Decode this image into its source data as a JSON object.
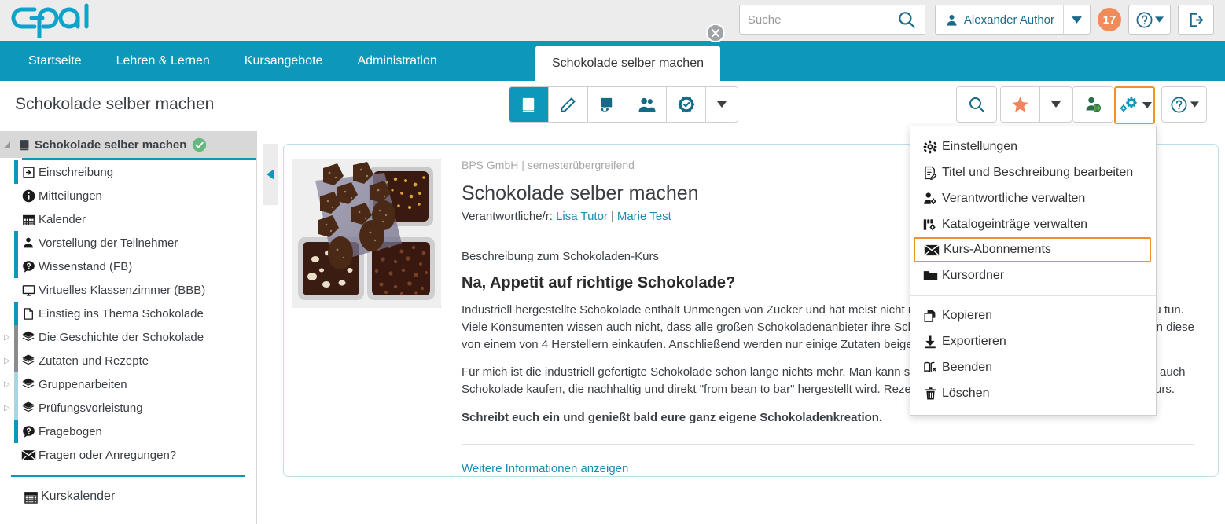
{
  "header": {
    "logo_alt": "OPAL",
    "search": {
      "placeholder": "Suche",
      "value": ""
    },
    "user_name": "Alexander Author",
    "notification_count": "17",
    "icons": {
      "search": "search-icon",
      "user": "user-icon",
      "caret": "chevron-down-icon",
      "help": "help-icon",
      "logout": "logout-icon"
    }
  },
  "nav": {
    "links": [
      {
        "label": "Startseite"
      },
      {
        "label": "Lehren & Lernen"
      },
      {
        "label": "Kursangebote"
      },
      {
        "label": "Administration"
      }
    ],
    "open_tab": {
      "label": "Schokolade selber machen",
      "close": "✕"
    }
  },
  "course_bar": {
    "title": "Schokolade selber machen",
    "left_tools": [
      {
        "name": "course-run-button",
        "icon": "book-icon",
        "active": true
      },
      {
        "name": "course-edit-button",
        "icon": "pencil-icon",
        "active": false
      },
      {
        "name": "course-preview-button",
        "icon": "preview-eye-icon",
        "active": false
      },
      {
        "name": "course-members-button",
        "icon": "members-icon",
        "active": false
      },
      {
        "name": "course-quality-button",
        "icon": "badge-check-icon",
        "active": false
      },
      {
        "name": "course-more-button",
        "icon": "chevron-down-icon",
        "active": false
      }
    ],
    "right_tools": [
      {
        "name": "course-search-button",
        "icon": "search-icon"
      },
      {
        "name": "course-favorite-button",
        "icon": "star-icon"
      },
      {
        "name": "course-favorite-caret",
        "icon": "chevron-down-icon"
      },
      {
        "name": "course-share-button",
        "icon": "user-globe-icon"
      },
      {
        "name": "course-settings-button",
        "icon": "gear-icon",
        "highlighted": true
      },
      {
        "name": "course-help-button",
        "icon": "help-icon"
      }
    ]
  },
  "sidebar": {
    "items": [
      {
        "label": "Schokolade selber machen",
        "icon": "book-icon",
        "level": 0,
        "root": true,
        "status": "check-circle-icon",
        "twisty": "◢"
      },
      {
        "label": "Einschreibung",
        "icon": "enrol-icon",
        "level": 1,
        "bar": "#0d97b8"
      },
      {
        "label": "Mitteilungen",
        "icon": "info-icon",
        "level": 1,
        "bar": ""
      },
      {
        "label": "Kalender",
        "icon": "calendar-icon",
        "level": 1,
        "bar": ""
      },
      {
        "label": "Vorstellung der Teilnehmer",
        "icon": "person-icon",
        "level": 1,
        "bar": "#0d97b8"
      },
      {
        "label": "Wissenstand (FB)",
        "icon": "question-bubble-icon",
        "level": 1,
        "bar": "#0d97b8"
      },
      {
        "label": "Virtuelles Klassenzimmer (BBB)",
        "icon": "monitor-icon",
        "level": 1,
        "bar": ""
      },
      {
        "label": "Einstieg ins Thema Schokolade",
        "icon": "page-icon",
        "level": 1,
        "bar": "#0d97b8"
      },
      {
        "label": "Die Geschichte der Schokolade",
        "icon": "layers-icon",
        "level": 1,
        "bar": "#8c8c8c",
        "twisty": "▷"
      },
      {
        "label": "Zutaten und Rezepte",
        "icon": "layers-icon",
        "level": 1,
        "bar": "#8c8c8c",
        "twisty": "▷"
      },
      {
        "label": "Gruppenarbeiten",
        "icon": "layers-icon",
        "level": 1,
        "bar": "#a8d5e2",
        "twisty": "▷"
      },
      {
        "label": "Prüfungsvorleistung",
        "icon": "layers-icon",
        "level": 1,
        "bar": "#a8d5e2",
        "twisty": "▷"
      },
      {
        "label": "Fragebogen",
        "icon": "question-bubble-icon",
        "level": 1,
        "bar": "#0d97b8"
      },
      {
        "label": "Fragen oder Anregungen?",
        "icon": "envelope-icon",
        "level": 1,
        "bar": ""
      }
    ],
    "footer_items": [
      {
        "label": "Kurskalender",
        "icon": "calendar-icon"
      }
    ]
  },
  "panel": {
    "meta": "BPS GmbH | semesterübergreifend",
    "title": "Schokolade selber machen",
    "responsible_label": "Verantwortliche/r:",
    "responsible": [
      "Lisa Tutor",
      "Marie Test"
    ],
    "description_label": "Beschreibung zum Schokoladen-Kurs",
    "heading": "Na, Appetit auf richtige Schokolade?",
    "paragraphs": [
      "Industriell hergestellte Schokolade enthält Unmengen von Zucker und hat meist nicht mehr viel mit der ursprünglichen Kakaobohne zu tun. Viele Konsumenten wissen auch nicht, dass alle großen Schokoladenanbieter ihre Schokoladenmasse nicht selbst herstellen, sondern diese von einem von 4 Herstellern einkaufen. Anschließend werden nur einige Zutaten beigemischt.",
      "Für mich ist die industriell gefertigte Schokolade schon lange nichts mehr. Man kann sich seine Schokolade auch selbst machen oder auch Schokolade kaufen, die nachhaltig und direkt \"from bean to bar\" hergestellt wird. Rezepte und weitere Informationen gibt es hier im Kurs."
    ],
    "closing": "Schreibt euch ein und genießt bald eure ganz eigene Schokoladenkreation.",
    "more_link": "Weitere Informationen anzeigen"
  },
  "menu": {
    "groups": [
      {
        "items": [
          {
            "label": "Einstellungen",
            "icon": "gear-icon",
            "highlighted": false
          },
          {
            "label": "Titel und Beschreibung bearbeiten",
            "icon": "document-edit-icon",
            "highlighted": false
          },
          {
            "label": "Verantwortliche verwalten",
            "icon": "person-gear-icon",
            "highlighted": false
          },
          {
            "label": "Katalogeinträge verwalten",
            "icon": "catalog-gear-icon",
            "highlighted": false
          },
          {
            "label": "Kurs-Abonnements",
            "icon": "envelope-icon",
            "highlighted": true
          },
          {
            "label": "Kursordner",
            "icon": "folder-icon",
            "highlighted": false
          }
        ]
      },
      {
        "items": [
          {
            "label": "Kopieren",
            "icon": "copy-icon",
            "highlighted": false
          },
          {
            "label": "Exportieren",
            "icon": "download-icon",
            "highlighted": false
          },
          {
            "label": "Beenden",
            "icon": "book-close-icon",
            "highlighted": false
          },
          {
            "label": "Löschen",
            "icon": "trash-icon",
            "highlighted": false
          }
        ]
      }
    ]
  },
  "colors": {
    "brand_teal": "#0d97b8",
    "highlight_orange": "#f0922b",
    "badge_orange": "#f08c5a",
    "link_blue": "#1b8bb0"
  }
}
